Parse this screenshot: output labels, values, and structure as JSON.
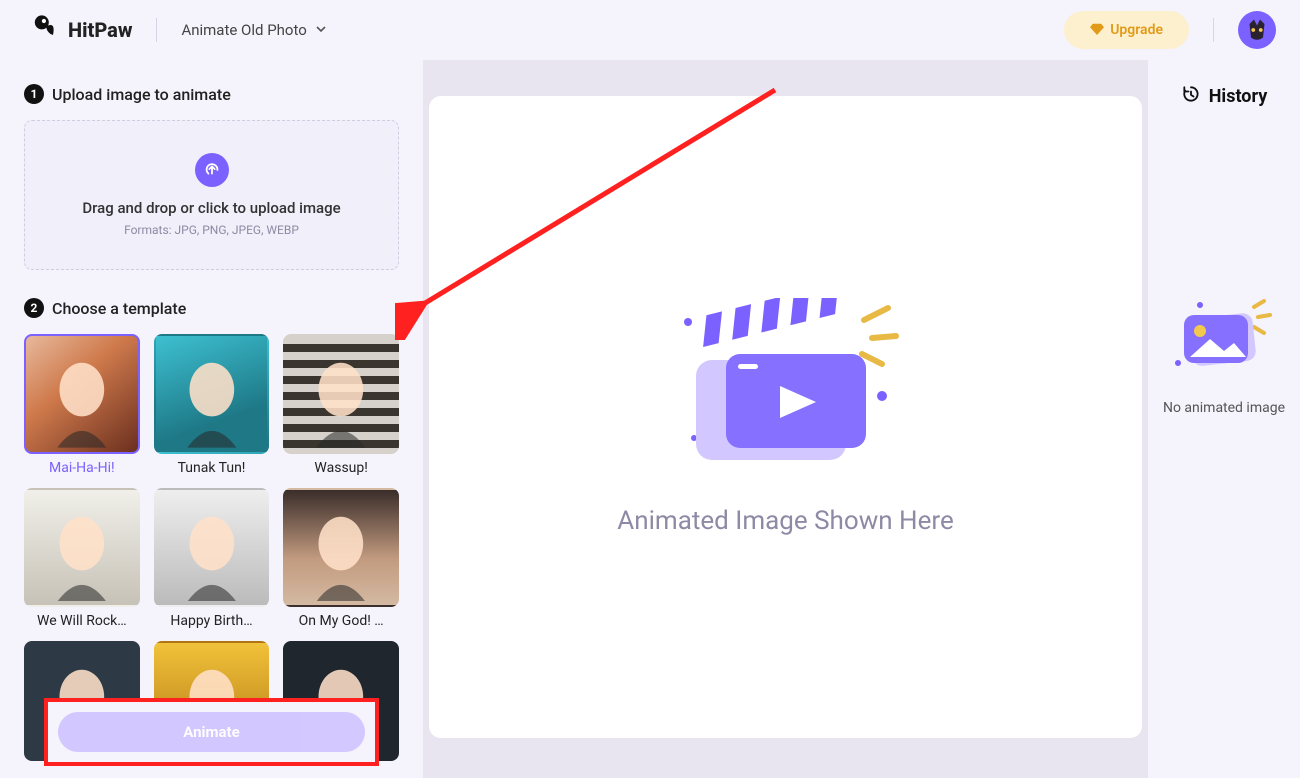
{
  "header": {
    "brand_name": "HitPaw",
    "mode_label": "Animate Old Photo",
    "upgrade_label": "Upgrade"
  },
  "left": {
    "step1_label": "Upload image to animate",
    "upload_cta": "Drag and drop or click to upload image",
    "upload_formats": "Formats: JPG, PNG, JPEG, WEBP",
    "step2_label": "Choose a template",
    "templates": [
      {
        "label": "Mai-Ha-Hi!",
        "selected": true,
        "bg": "linear-gradient(140deg,#e7b99c 0%,#cf7a4c 40%,#6b2f1e 100%)"
      },
      {
        "label": "Tunak Tun!",
        "selected": false,
        "bg": "linear-gradient(160deg,#3dc0d1 0%,#1e7886 70%)"
      },
      {
        "label": "Wassup!",
        "selected": false,
        "bg": "repeating-linear-gradient(180deg,#d6d2cb 0 8px,#3a362f 8px 16px)"
      },
      {
        "label": "We Will Rock…",
        "selected": false,
        "bg": "linear-gradient(180deg,#f0efe9 0%,#c7c2b7 100%)"
      },
      {
        "label": "Happy Birth…",
        "selected": false,
        "bg": "linear-gradient(180deg,#eee 0%,#bbb 100%)"
      },
      {
        "label": "On My God! …",
        "selected": false,
        "bg": "linear-gradient(180deg,#3a2d2a 0%,#c29b7f 60%,#d4b9a2 100%)"
      },
      {
        "label": "",
        "selected": false,
        "bg": "#2d3a45"
      },
      {
        "label": "",
        "selected": false,
        "bg": "linear-gradient(180deg,#f1c23a 0%,#b07412 100%)"
      },
      {
        "label": "",
        "selected": false,
        "bg": "#1f262e"
      }
    ],
    "animate_label": "Animate"
  },
  "center": {
    "placeholder_text": "Animated Image Shown Here"
  },
  "right": {
    "heading": "History",
    "empty_text": "No animated image"
  }
}
